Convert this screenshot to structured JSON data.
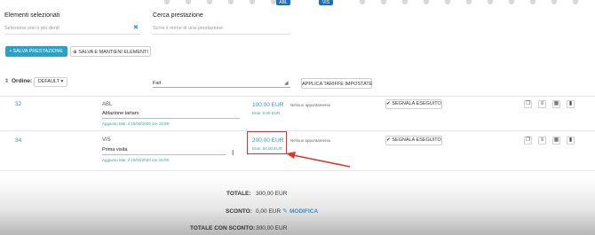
{
  "top_badges": [
    "ABL",
    "VIS"
  ],
  "selected": {
    "label": "Elementi selezionati",
    "placeholder": "Seleziona uno o più denti",
    "clear_icon": "close-icon"
  },
  "search": {
    "label": "Cerca prestazione",
    "placeholder": "Scrivi il nome di una prestazione"
  },
  "actions": {
    "save": "SALVA PRESTAZIONE",
    "save_keep": "SALVA E MANTIENI ELEMENTI"
  },
  "order": {
    "label": "Ordine:",
    "value": "DEFAULT",
    "tariff_value": "Fait",
    "apply": "APPLICA TARIFFE IMPOSTATE"
  },
  "rows": [
    {
      "tooth": "32",
      "code": "ABL",
      "name": "Ablazione tartaro",
      "added": "Aggiunto Mar. il 10/03/2020 ore 15:09",
      "price": "100,00 EUR",
      "cost": "Ente: 0,00 EUR",
      "appointment": "Nessun appuntamento",
      "done_button": "SEGNALA ESEGUITO"
    },
    {
      "tooth": "34",
      "code": "VIS",
      "name": "Prima visita",
      "added": "Aggiunto Mar. il 10/03/2020 ore 15:09",
      "price": "200,00 EUR",
      "cost": "Ente: 50,00 EUR",
      "appointment": "Nessun appuntamento",
      "done_button": "SEGNALA ESEGUITO"
    }
  ],
  "totals": {
    "total_label": "TOTALE:",
    "total_value": "300,00 EUR",
    "discount_label": "SCONTO:",
    "discount_value": "0,00 EUR",
    "edit_label": "MODIFICA",
    "net_label": "TOTALE CON SCONTO:",
    "net_value": "300,00 EUR"
  },
  "colors": {
    "accent": "#2aa1c6",
    "link": "#3a8cc4",
    "highlight": "#e0332b"
  }
}
